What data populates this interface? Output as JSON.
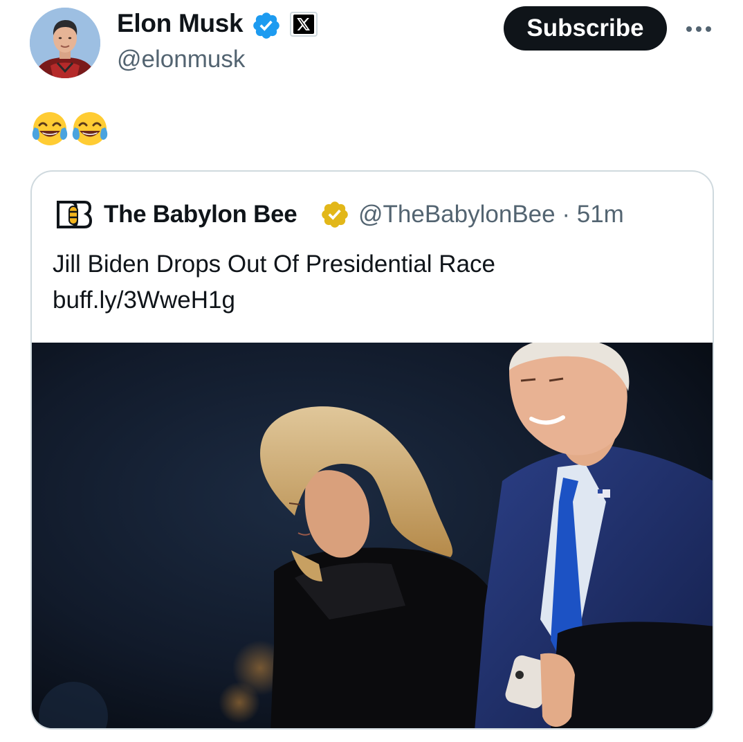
{
  "post": {
    "author": {
      "name": "Elon Musk",
      "handle": "@elonmusk",
      "verified": true,
      "badge_icon": "x-logo-icon"
    },
    "subscribe_label": "Subscribe",
    "more_label": "More",
    "body_emoji": [
      "face-with-tears-of-joy",
      "face-with-tears-of-joy"
    ]
  },
  "quoted_post": {
    "author": {
      "name": "The Babylon Bee",
      "handle": "@TheBabylonBee",
      "verified": true,
      "verified_color": "#e2b719"
    },
    "separator": "·",
    "time": "51m",
    "text": "Jill Biden Drops Out Of Presidential Race",
    "link": "buff.ly/3WweH1g",
    "media": {
      "type": "photo",
      "content": "Jill Biden and Joe Biden walking at night"
    }
  },
  "colors": {
    "text_primary": "#0f1419",
    "text_secondary": "#536471",
    "border": "#cfd9de",
    "verified_blue": "#1d9bf0",
    "button_dark": "#0f1419"
  }
}
